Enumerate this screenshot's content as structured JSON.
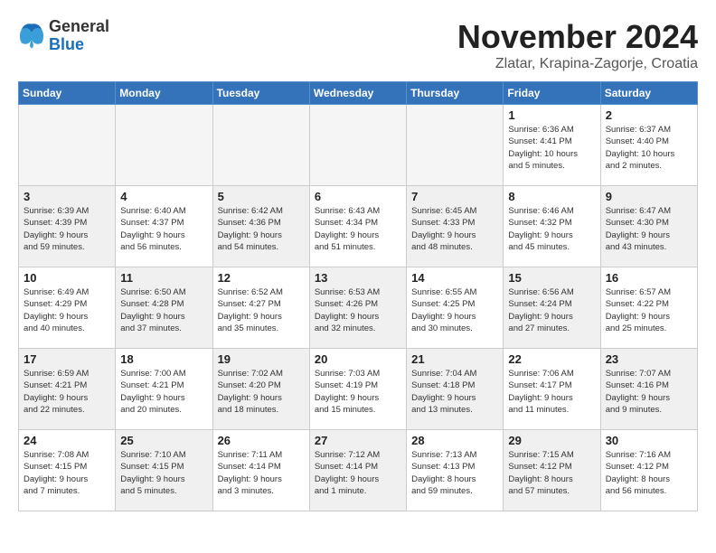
{
  "logo": {
    "general": "General",
    "blue": "Blue"
  },
  "header": {
    "month": "November 2024",
    "location": "Zlatar, Krapina-Zagorje, Croatia"
  },
  "weekdays": [
    "Sunday",
    "Monday",
    "Tuesday",
    "Wednesday",
    "Thursday",
    "Friday",
    "Saturday"
  ],
  "weeks": [
    [
      {
        "day": "",
        "info": "",
        "empty": true
      },
      {
        "day": "",
        "info": "",
        "empty": true
      },
      {
        "day": "",
        "info": "",
        "empty": true
      },
      {
        "day": "",
        "info": "",
        "empty": true
      },
      {
        "day": "",
        "info": "",
        "empty": true
      },
      {
        "day": "1",
        "info": "Sunrise: 6:36 AM\nSunset: 4:41 PM\nDaylight: 10 hours\nand 5 minutes."
      },
      {
        "day": "2",
        "info": "Sunrise: 6:37 AM\nSunset: 4:40 PM\nDaylight: 10 hours\nand 2 minutes."
      }
    ],
    [
      {
        "day": "3",
        "info": "Sunrise: 6:39 AM\nSunset: 4:39 PM\nDaylight: 9 hours\nand 59 minutes.",
        "shaded": true
      },
      {
        "day": "4",
        "info": "Sunrise: 6:40 AM\nSunset: 4:37 PM\nDaylight: 9 hours\nand 56 minutes."
      },
      {
        "day": "5",
        "info": "Sunrise: 6:42 AM\nSunset: 4:36 PM\nDaylight: 9 hours\nand 54 minutes.",
        "shaded": true
      },
      {
        "day": "6",
        "info": "Sunrise: 6:43 AM\nSunset: 4:34 PM\nDaylight: 9 hours\nand 51 minutes."
      },
      {
        "day": "7",
        "info": "Sunrise: 6:45 AM\nSunset: 4:33 PM\nDaylight: 9 hours\nand 48 minutes.",
        "shaded": true
      },
      {
        "day": "8",
        "info": "Sunrise: 6:46 AM\nSunset: 4:32 PM\nDaylight: 9 hours\nand 45 minutes."
      },
      {
        "day": "9",
        "info": "Sunrise: 6:47 AM\nSunset: 4:30 PM\nDaylight: 9 hours\nand 43 minutes.",
        "shaded": true
      }
    ],
    [
      {
        "day": "10",
        "info": "Sunrise: 6:49 AM\nSunset: 4:29 PM\nDaylight: 9 hours\nand 40 minutes."
      },
      {
        "day": "11",
        "info": "Sunrise: 6:50 AM\nSunset: 4:28 PM\nDaylight: 9 hours\nand 37 minutes.",
        "shaded": true
      },
      {
        "day": "12",
        "info": "Sunrise: 6:52 AM\nSunset: 4:27 PM\nDaylight: 9 hours\nand 35 minutes."
      },
      {
        "day": "13",
        "info": "Sunrise: 6:53 AM\nSunset: 4:26 PM\nDaylight: 9 hours\nand 32 minutes.",
        "shaded": true
      },
      {
        "day": "14",
        "info": "Sunrise: 6:55 AM\nSunset: 4:25 PM\nDaylight: 9 hours\nand 30 minutes."
      },
      {
        "day": "15",
        "info": "Sunrise: 6:56 AM\nSunset: 4:24 PM\nDaylight: 9 hours\nand 27 minutes.",
        "shaded": true
      },
      {
        "day": "16",
        "info": "Sunrise: 6:57 AM\nSunset: 4:22 PM\nDaylight: 9 hours\nand 25 minutes."
      }
    ],
    [
      {
        "day": "17",
        "info": "Sunrise: 6:59 AM\nSunset: 4:21 PM\nDaylight: 9 hours\nand 22 minutes.",
        "shaded": true
      },
      {
        "day": "18",
        "info": "Sunrise: 7:00 AM\nSunset: 4:21 PM\nDaylight: 9 hours\nand 20 minutes."
      },
      {
        "day": "19",
        "info": "Sunrise: 7:02 AM\nSunset: 4:20 PM\nDaylight: 9 hours\nand 18 minutes.",
        "shaded": true
      },
      {
        "day": "20",
        "info": "Sunrise: 7:03 AM\nSunset: 4:19 PM\nDaylight: 9 hours\nand 15 minutes."
      },
      {
        "day": "21",
        "info": "Sunrise: 7:04 AM\nSunset: 4:18 PM\nDaylight: 9 hours\nand 13 minutes.",
        "shaded": true
      },
      {
        "day": "22",
        "info": "Sunrise: 7:06 AM\nSunset: 4:17 PM\nDaylight: 9 hours\nand 11 minutes."
      },
      {
        "day": "23",
        "info": "Sunrise: 7:07 AM\nSunset: 4:16 PM\nDaylight: 9 hours\nand 9 minutes.",
        "shaded": true
      }
    ],
    [
      {
        "day": "24",
        "info": "Sunrise: 7:08 AM\nSunset: 4:15 PM\nDaylight: 9 hours\nand 7 minutes."
      },
      {
        "day": "25",
        "info": "Sunrise: 7:10 AM\nSunset: 4:15 PM\nDaylight: 9 hours\nand 5 minutes.",
        "shaded": true
      },
      {
        "day": "26",
        "info": "Sunrise: 7:11 AM\nSunset: 4:14 PM\nDaylight: 9 hours\nand 3 minutes."
      },
      {
        "day": "27",
        "info": "Sunrise: 7:12 AM\nSunset: 4:14 PM\nDaylight: 9 hours\nand 1 minute.",
        "shaded": true
      },
      {
        "day": "28",
        "info": "Sunrise: 7:13 AM\nSunset: 4:13 PM\nDaylight: 8 hours\nand 59 minutes."
      },
      {
        "day": "29",
        "info": "Sunrise: 7:15 AM\nSunset: 4:12 PM\nDaylight: 8 hours\nand 57 minutes.",
        "shaded": true
      },
      {
        "day": "30",
        "info": "Sunrise: 7:16 AM\nSunset: 4:12 PM\nDaylight: 8 hours\nand 56 minutes."
      }
    ]
  ]
}
